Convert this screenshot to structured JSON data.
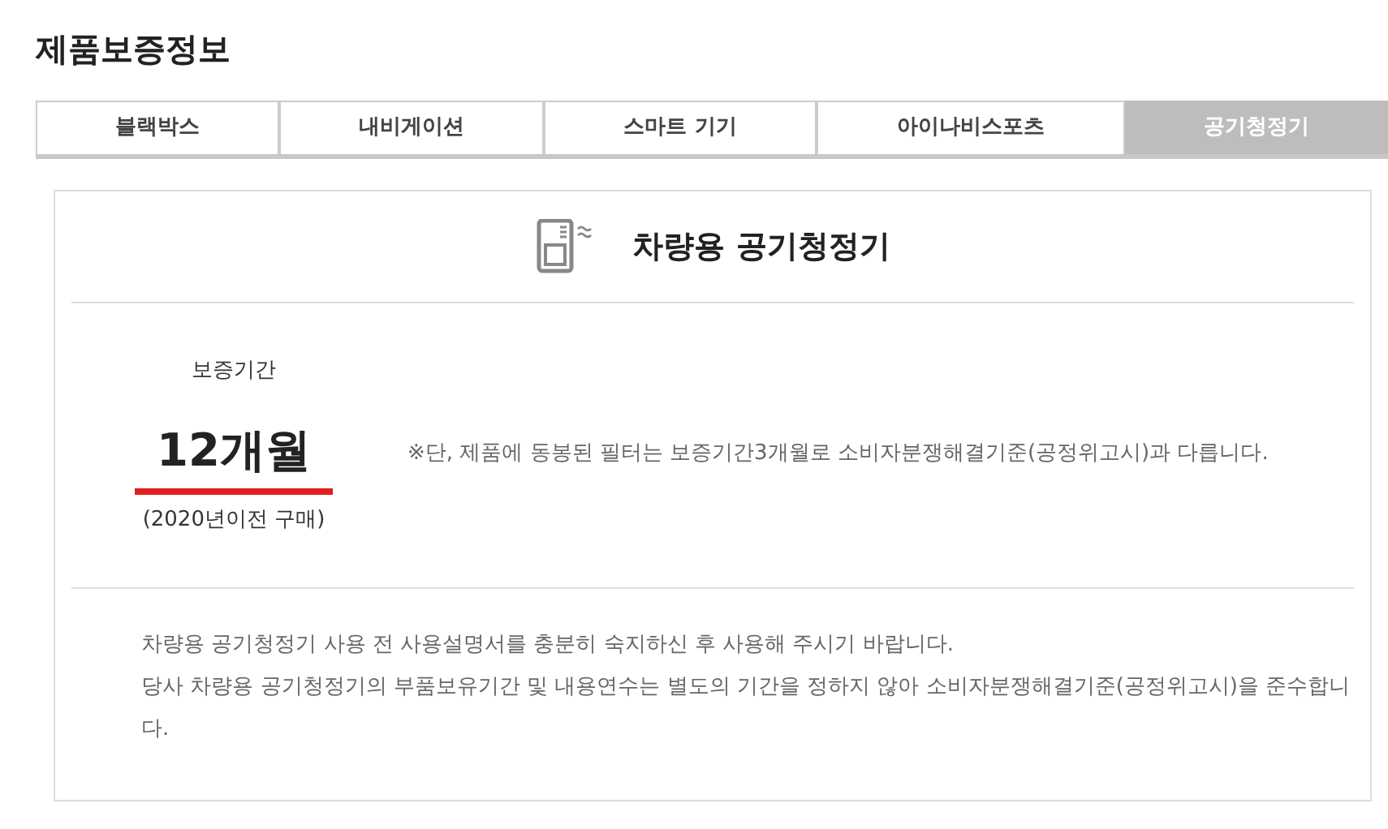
{
  "page_title": "제품보증정보",
  "tabs": [
    {
      "label": "블랙박스",
      "selected": false
    },
    {
      "label": "내비게이션",
      "selected": false
    },
    {
      "label": "스마트 기기",
      "selected": false
    },
    {
      "label": "아이나비스포츠",
      "selected": false
    },
    {
      "label": "공기청정기",
      "selected": true
    }
  ],
  "product": {
    "title": "차량용 공기청정기"
  },
  "warranty": {
    "label": "보증기간",
    "period": "12개월",
    "condition": "(2020년이전 구매)",
    "note": "※단, 제품에 동봉된 필터는 보증기간3개월로 소비자분쟁해결기준(공정위고시)과 다릅니다."
  },
  "notices": [
    "차량용 공기청정기 사용 전 사용설명서를 충분히 숙지하신 후 사용해 주시기 바랍니다.",
    "당사 차량용 공기청정기의 부품보유기간 및 내용연수는 별도의 기간을 정하지 않아 소비자분쟁해결기준(공정위고시)을 준수합니다."
  ]
}
